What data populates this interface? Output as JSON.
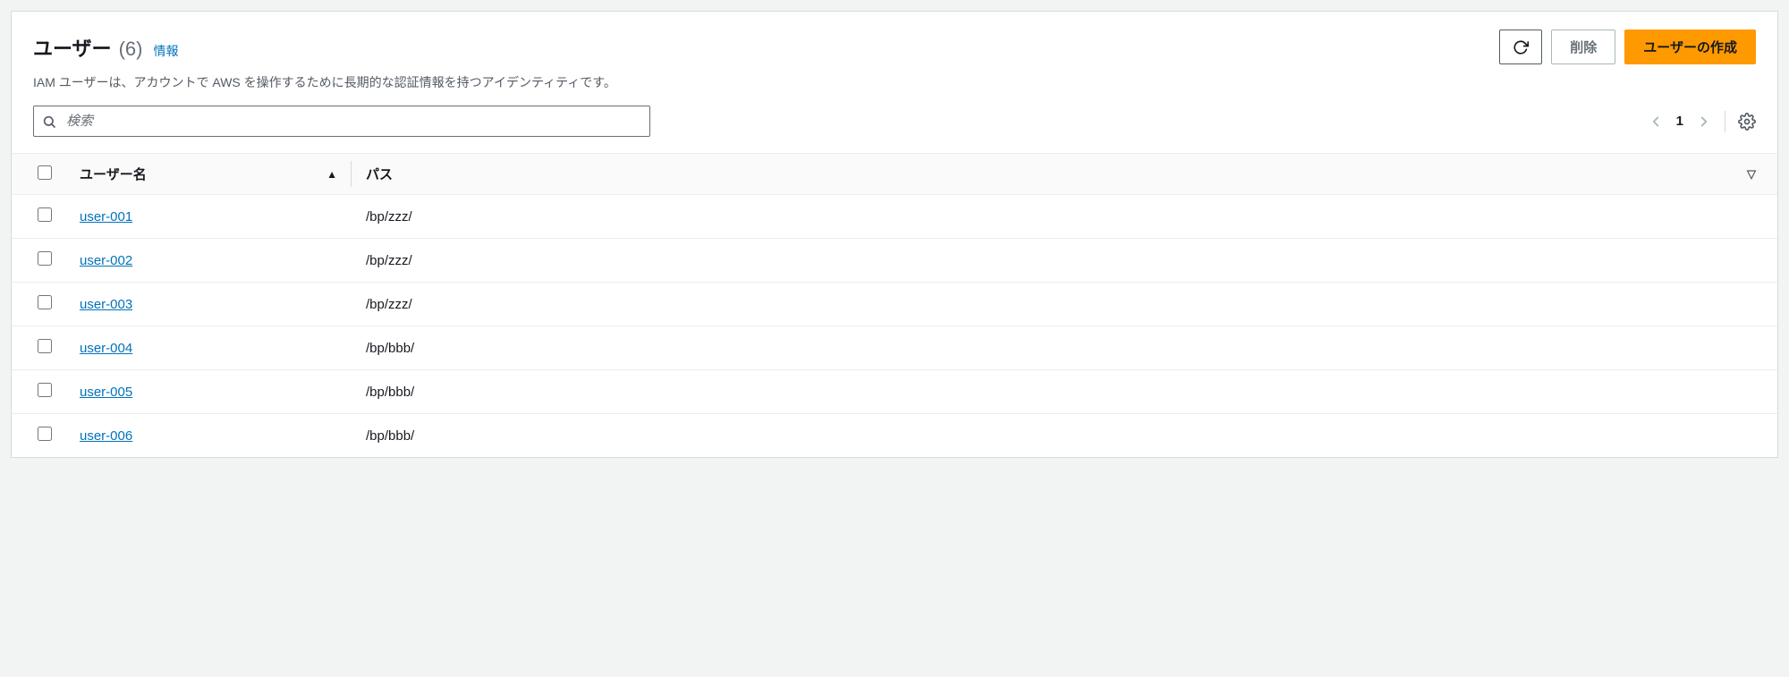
{
  "header": {
    "title": "ユーザー",
    "count": "(6)",
    "info_link": "情報",
    "description": "IAM ユーザーは、アカウントで AWS を操作するために長期的な認証情報を持つアイデンティティです。"
  },
  "actions": {
    "delete_label": "削除",
    "create_label": "ユーザーの作成"
  },
  "search": {
    "placeholder": "検索"
  },
  "pagination": {
    "current": "1"
  },
  "table": {
    "columns": {
      "username": "ユーザー名",
      "path": "パス"
    },
    "rows": [
      {
        "username": "user-001",
        "path": "/bp/zzz/"
      },
      {
        "username": "user-002",
        "path": "/bp/zzz/"
      },
      {
        "username": "user-003",
        "path": "/bp/zzz/"
      },
      {
        "username": "user-004",
        "path": "/bp/bbb/"
      },
      {
        "username": "user-005",
        "path": "/bp/bbb/"
      },
      {
        "username": "user-006",
        "path": "/bp/bbb/"
      }
    ]
  }
}
